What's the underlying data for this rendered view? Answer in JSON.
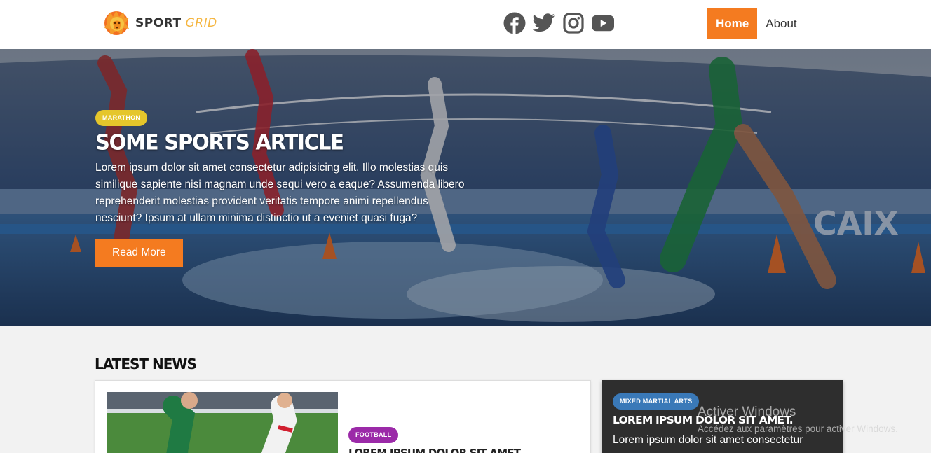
{
  "brand": {
    "name_bold": "SPORT",
    "name_light": "GRID"
  },
  "socials": [
    {
      "icon": "facebook-icon"
    },
    {
      "icon": "twitter-icon"
    },
    {
      "icon": "instagram-icon"
    },
    {
      "icon": "youtube-icon"
    }
  ],
  "nav": {
    "home": "Home",
    "about": "About"
  },
  "hero": {
    "tag": "MARATHON",
    "title": "SOME SPORTS ARTICLE",
    "text": "Lorem ipsum dolor sit amet consectetur adipisicing elit. Illo molestias quis similique sapiente nisi magnam unde sequi vero a eaque? Assumenda libero reprehenderit molestias provident veritatis tempore animi repellendus nesciunt? Ipsum at ullam minima distinctio ut a eveniet quasi fuga?",
    "button": "Read More"
  },
  "latest": {
    "heading": "LATEST NEWS",
    "main_card": {
      "tag": "FOOTBALL",
      "title": "LOREM IPSUM DOLOR SIT AMET."
    },
    "side_card": {
      "tag": "MIXED MARTIAL ARTS",
      "title": "LOREM IPSUM DOLOR SIT AMET.",
      "text": "Lorem ipsum dolor sit amet consectetur"
    }
  },
  "watermark": {
    "title": "Activer Windows",
    "subtitle": "Accédez aux paramètres pour activer Windows."
  },
  "colors": {
    "accent": "#f47b20",
    "marathon_tag": "#e5c62b",
    "football_tag": "#9b2aa8",
    "mma_tag": "#3a79b8",
    "dark_card": "#2e2e2e"
  }
}
